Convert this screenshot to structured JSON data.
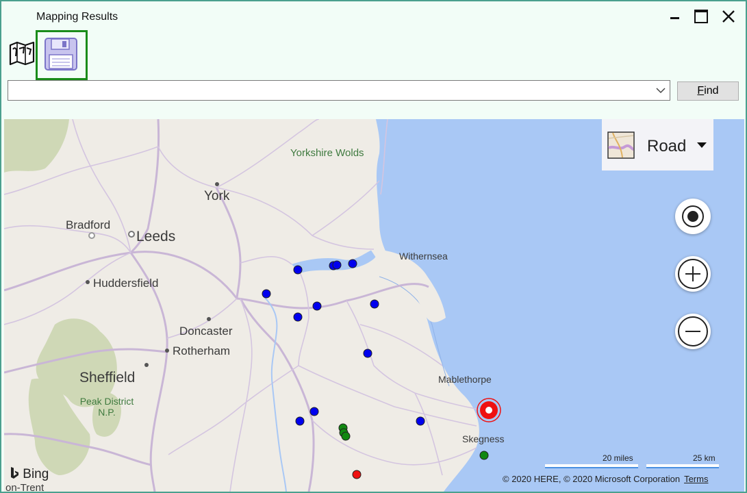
{
  "window": {
    "title": "Mapping Results",
    "controls": [
      "minimize",
      "maximize",
      "close"
    ]
  },
  "toolbar": {
    "map_icon": "map-icon",
    "save_icon": "save-icon",
    "save_selected": true,
    "selected_color": "#1a8c1a"
  },
  "search": {
    "value": "",
    "find_label": "Find",
    "find_access_key": "F"
  },
  "map": {
    "style_selector": {
      "label": "Road",
      "icon": "road-map-icon"
    },
    "controls": [
      "locate-me",
      "zoom-in",
      "zoom-out"
    ],
    "places": [
      {
        "name": "Yorkshire Wolds"
      },
      {
        "name": "York"
      },
      {
        "name": "Bradford"
      },
      {
        "name": "Leeds"
      },
      {
        "name": "Huddersfield"
      },
      {
        "name": "Doncaster"
      },
      {
        "name": "Rotherham"
      },
      {
        "name": "Sheffield"
      },
      {
        "name": "Peak District N.P."
      },
      {
        "name": "Withernsea"
      },
      {
        "name": "Mablethorpe"
      },
      {
        "name": "Skegness"
      },
      {
        "name": "on-Trent"
      }
    ],
    "pins": {
      "blue": 12,
      "green": 4,
      "red": 1,
      "target": 1
    },
    "pin_colors": {
      "blue": "#0000ee",
      "green": "#118811",
      "red": "#ee1111",
      "sea": "#a9c8f5",
      "land": "#efece6"
    },
    "scale_bar": {
      "miles": "20 miles",
      "km": "25 km"
    },
    "copyright": "© 2020 HERE, © 2020 Microsoft Corporation",
    "terms": "Terms",
    "brand": "Bing"
  }
}
